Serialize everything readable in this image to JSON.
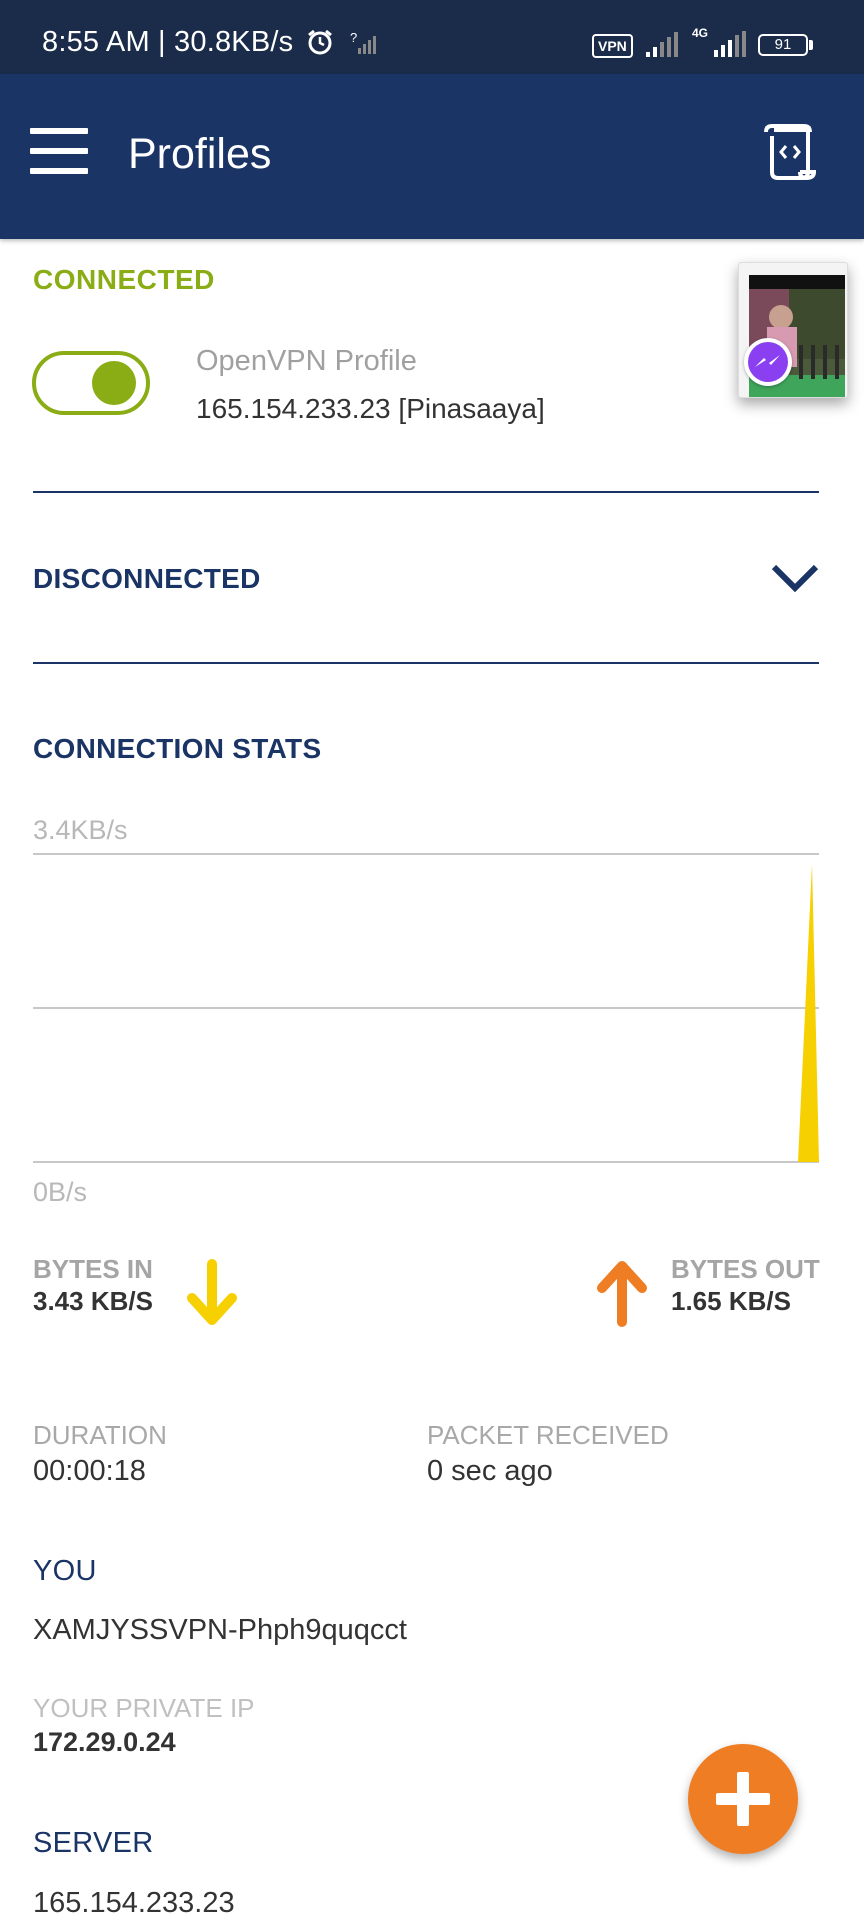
{
  "status_bar": {
    "time_speed": "8:55 AM | 30.8KB/s",
    "qsignal": "?",
    "vpn_badge": "VPN",
    "network": "4G",
    "battery": "91"
  },
  "app_bar": {
    "title": "Profiles",
    "menu_icon": "hamburger-menu-icon",
    "log_icon": "log-scroll-icon"
  },
  "connected": {
    "label": "CONNECTED",
    "profile_name": "OpenVPN Profile",
    "profile_server": "165.154.233.23 [Pinasaaya]",
    "toggle_on": true
  },
  "disconnected": {
    "label": "DISCONNECTED"
  },
  "stats": {
    "title": "CONNECTION STATS",
    "chart_max_label": "3.4KB/s",
    "chart_min_label": "0B/s",
    "bytes_in_label": "BYTES IN",
    "bytes_in_value": "3.43 KB/S",
    "bytes_out_label": "BYTES OUT",
    "bytes_out_value": "1.65 KB/S",
    "duration_label": "DURATION",
    "duration_value": "00:00:18",
    "packet_label": "PACKET RECEIVED",
    "packet_value": "0 sec ago"
  },
  "you": {
    "title": "YOU",
    "name": "XAMJYSSVPN-Phph9quqcct",
    "private_ip_label": "YOUR PRIVATE IP",
    "private_ip": "172.29.0.24"
  },
  "server": {
    "title": "SERVER",
    "ip": "165.154.233.23"
  },
  "colors": {
    "app_bar": "#1a3466",
    "status_bar": "#1b2b4a",
    "connected_green": "#8aac14",
    "bytes_in_yellow": "#f6d000",
    "bytes_out_orange": "#ef7d24",
    "fab": "#ef7d24"
  }
}
